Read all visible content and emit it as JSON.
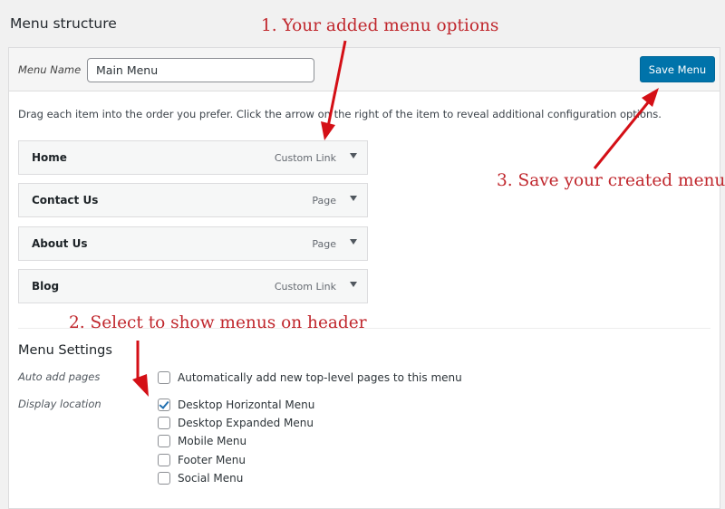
{
  "page": {
    "title": "Menu structure"
  },
  "header": {
    "menu_name_label": "Menu Name",
    "menu_name_value": "Main Menu",
    "save_label": "Save Menu"
  },
  "instructions": "Drag each item into the order you prefer. Click the arrow on the right of the item to reveal additional configuration options.",
  "menu_items": [
    {
      "title": "Home",
      "type": "Custom Link"
    },
    {
      "title": "Contact Us",
      "type": "Page"
    },
    {
      "title": "About Us",
      "type": "Page"
    },
    {
      "title": "Blog",
      "type": "Custom Link"
    }
  ],
  "settings": {
    "title": "Menu Settings",
    "auto_add_label": "Auto add pages",
    "auto_add_option": {
      "label": "Automatically add new top-level pages to this menu",
      "checked": false
    },
    "display_location_label": "Display location",
    "locations": [
      {
        "label": "Desktop Horizontal Menu",
        "checked": true
      },
      {
        "label": "Desktop Expanded Menu",
        "checked": false
      },
      {
        "label": "Mobile Menu",
        "checked": false
      },
      {
        "label": "Footer Menu",
        "checked": false
      },
      {
        "label": "Social Menu",
        "checked": false
      }
    ]
  },
  "annotations": {
    "step1": "1. Your added menu options",
    "step2": "2. Select to show menus on header",
    "step3": "3. Save your created menu",
    "color": "#c0272d"
  },
  "colors": {
    "accent": "#0073aa",
    "background": "#f1f1f1"
  }
}
